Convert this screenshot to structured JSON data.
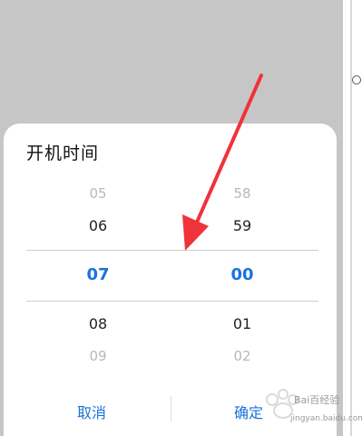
{
  "dialog": {
    "title": "开机时间",
    "hours": {
      "far_above": "05",
      "near_above": "06",
      "selected": "07",
      "near_below": "08",
      "far_below": "09"
    },
    "minutes": {
      "far_above": "58",
      "near_above": "59",
      "selected": "00",
      "near_below": "01",
      "far_below": "02"
    },
    "buttons": {
      "cancel": "取消",
      "confirm": "确定"
    }
  },
  "watermark": {
    "brand": "Bai百经验",
    "url": "jingyan.baidu.com"
  },
  "colors": {
    "accent": "#1a73d9",
    "overlay": "#c6c6c6",
    "annotation_arrow": "#f0323a"
  }
}
